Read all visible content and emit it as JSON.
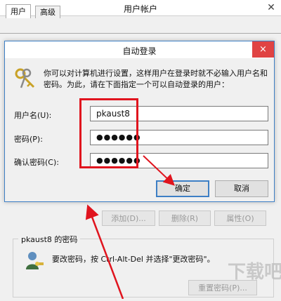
{
  "parent_window": {
    "title": "用户帐户",
    "tabs": [
      {
        "label": "用户",
        "active": true
      },
      {
        "label": "高级",
        "active": false
      }
    ],
    "buttons": {
      "add": "添加(D)...",
      "delete": "删除(R)",
      "properties": "属性(O)"
    },
    "password_group": {
      "title": "pkaust8 的密码",
      "text": "要改密码，按 Ctrl-Alt-Del 并选择\"更改密码\"。",
      "reset_button": "重置密码(P)..."
    }
  },
  "dialog": {
    "title": "自动登录",
    "close_icon": "×",
    "description": "你可以对计算机进行设置，这样用户在登录时就不必输入用户名和密码。为此，请在下面指定一个可以自动登录的用户：",
    "username_label": "用户名(U):",
    "username_value": "pkaust8",
    "password_label": "密码(P):",
    "password_value": "●●●●●●",
    "confirm_label": "确认密码(C):",
    "confirm_value": "●●●●●●",
    "ok_button": "确定",
    "cancel_button": "取消"
  },
  "watermark": "下载吧",
  "colors": {
    "accent": "#3d7fc5",
    "close_red": "#e04343",
    "annotation_red": "#e0141e"
  }
}
